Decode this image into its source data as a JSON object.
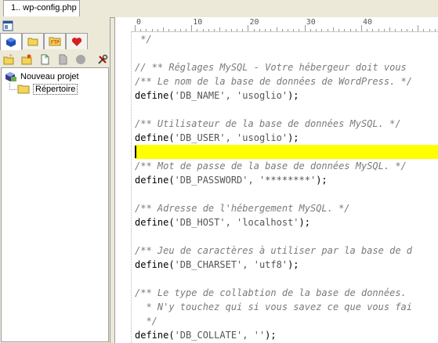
{
  "tab": {
    "label": "1.. wp-config.php"
  },
  "ruler": {
    "marks": [
      "0",
      "10",
      "20",
      "30",
      "40"
    ]
  },
  "tree": {
    "project": "Nouveau projet",
    "folder": "Répertoire"
  },
  "code": {
    "lines": [
      {
        "cm": " */"
      },
      {
        "cm": ""
      },
      {
        "cm": "// ** Réglages MySQL - Votre hébergeur doit vous"
      },
      {
        "cm": "/** Le nom de la base de données de WordPress. */"
      },
      {
        "fn": "define(",
        "st": "'DB_NAME', 'usoglio'",
        "end": ");"
      },
      {
        "cm": ""
      },
      {
        "cm": "/** Utilisateur de la base de données MySQL. */"
      },
      {
        "fn": "define(",
        "st": "'DB_USER', 'usoglio'",
        "end": ");"
      },
      {
        "cm": ""
      },
      {
        "cm": "/** Mot de passe de la base de données MySQL. */"
      },
      {
        "fn": "define(",
        "st": "'DB_PASSWORD', '********'",
        "end": ");"
      },
      {
        "cm": ""
      },
      {
        "cm": "/** Adresse de l'hébergement MySQL. */"
      },
      {
        "fn": "define(",
        "st": "'DB_HOST', 'localhost'",
        "end": ");"
      },
      {
        "cm": ""
      },
      {
        "cm": "/** Jeu de caractères à utiliser par la base de d"
      },
      {
        "fn": "define(",
        "st": "'DB_CHARSET', 'utf8'",
        "end": ");"
      },
      {
        "cm": ""
      },
      {
        "cm": "/** Le type de collabtion de la base de données."
      },
      {
        "cm": "  * N'y touchez qui si vous savez ce que vous fai"
      },
      {
        "cm": "  */"
      },
      {
        "fn": "define(",
        "st": "'DB_COLLATE', ''",
        "end": ");"
      }
    ],
    "highlight_line": 8
  },
  "colors": {
    "highlight": "#ffff00",
    "comment": "#7a7a7a"
  }
}
